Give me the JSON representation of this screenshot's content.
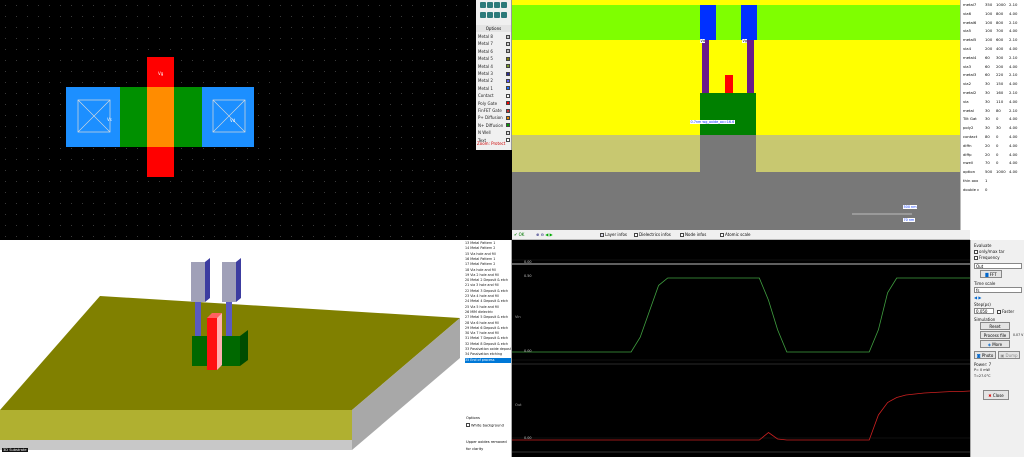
{
  "layout": {
    "labels": {
      "gate": "Vg",
      "drain": "Vd",
      "source": "Vs"
    }
  },
  "palette": {
    "header": "Options",
    "items": [
      {
        "label": "Metal 8",
        "color": "#c8c8c8"
      },
      {
        "label": "Metal 7",
        "color": "#d0d0d0"
      },
      {
        "label": "Metal 6",
        "color": "#b8b8b8"
      },
      {
        "label": "Metal 5",
        "color": "#808000"
      },
      {
        "label": "Metal 4",
        "color": "#7aa02a"
      },
      {
        "label": "Metal 3",
        "color": "#2b2b9b"
      },
      {
        "label": "Metal 2",
        "color": "#5a5aff"
      },
      {
        "label": "Metal 1",
        "color": "#1c6bff"
      },
      {
        "label": "Contact",
        "color": "#ffffff"
      },
      {
        "label": "Poly Gate",
        "color": "#ff0000"
      },
      {
        "label": "FinFET Gate",
        "color": "#cc3333"
      },
      {
        "label": "P+ Diffusion",
        "color": "#e88a00"
      },
      {
        "label": "N+ Diffusion",
        "color": "#00a000"
      },
      {
        "label": "N Well",
        "color": "#dddddd"
      },
      {
        "label": "Text",
        "color": "#ffffff"
      }
    ],
    "zoom_label": "Zoom",
    "zoom_value": "Protect"
  },
  "xsection": {
    "gate_label": "Vg",
    "drain_label": "Vd",
    "annotation": "0.7nm wg_oxide_ox=16.6",
    "scale_label": "500 nm",
    "scale_label2": "70 nm",
    "status": "Substrate"
  },
  "layer_table": {
    "rows": [
      [
        "metal7",
        "350",
        "1000",
        "2.10"
      ],
      [
        "via6",
        "100",
        "800",
        "4.00"
      ],
      [
        "metal6",
        "100",
        "800",
        "2.10"
      ],
      [
        "via5",
        "100",
        "700",
        "4.00"
      ],
      [
        "metal5",
        "100",
        "600",
        "2.10"
      ],
      [
        "via4",
        "200",
        "400",
        "4.00"
      ],
      [
        "metal4",
        "60",
        "300",
        "2.10"
      ],
      [
        "via3",
        "60",
        "200",
        "4.00"
      ],
      [
        "metal3",
        "60",
        "220",
        "2.10"
      ],
      [
        "via2",
        "30",
        "150",
        "4.00"
      ],
      [
        "metal2",
        "30",
        "160",
        "2.10"
      ],
      [
        "via",
        "30",
        "110",
        "4.00"
      ],
      [
        "metal",
        "30",
        "80",
        "2.10"
      ],
      [
        "Tilt Gat",
        "30",
        "0",
        "4.00"
      ],
      [
        "poly2",
        "30",
        "30",
        "4.00"
      ],
      [
        "contact",
        "80",
        "0",
        "4.00"
      ],
      [
        "diffn",
        "20",
        "0",
        "4.00"
      ],
      [
        "diffp",
        "20",
        "0",
        "4.00"
      ],
      [
        "nwell",
        "70",
        "0",
        "4.00"
      ],
      [
        "option",
        "500",
        "1000",
        "4.00"
      ],
      [
        "thin oxx",
        "1",
        "",
        ""
      ],
      [
        "double c",
        "0",
        "",
        ""
      ]
    ]
  },
  "view3d": {
    "status": "3D Substrate"
  },
  "process_list": {
    "items": [
      "13 Metal Pattern 1",
      "14 Metal Pattern 2",
      "15 Via hole and fill",
      "16 Metal Pattern 1",
      "17 Metal Pattern 2",
      "18 Via hole and fill",
      "19 Via 2 hole and fill",
      "20 Metal 2 Deposit & etch",
      "21 via 3 hole and fill",
      "22 Metal 3 Deposit & etch",
      "23 Via 4 hole and fill",
      "24 Metal 4 Deposit & etch",
      "25 Via 5 hole and fill",
      "26 MIM dielectric",
      "27 Metal 5 Deposit & etch",
      "28 Via 6 hole and fill",
      "29 Metal 6 Deposit & etch",
      "30 Via 7 hole and fill",
      "31 Metal 7 Deposit & etch",
      "32 Metal 8 Deposit & etch",
      "33 Passivation oxide deposit",
      "34 Passivation etching",
      "35 End of process"
    ],
    "selected_index": 22,
    "options_label": "Options",
    "white_bg_label": "White background",
    "upper_oxides_label": "Upper oxides removed",
    "for_clarity_label": "for clarity"
  },
  "sim_toolbar": {
    "ok": "OK",
    "layer_infos": "Layer infos",
    "dielectrics_infos": "Dielectrics infos",
    "node_infos": "Node infos",
    "atomic_scale": "Atomic scale"
  },
  "sim_plot": {
    "ticks": {
      "top": "0.00",
      "mid_hi": "0.50",
      "mid_lo": "0.00",
      "bottom": "0.00"
    },
    "labels": {
      "vin": "Vin",
      "out": "Out"
    }
  },
  "chart_data": {
    "type": "line",
    "title": "",
    "xlabel": "",
    "ylabel": "",
    "x": [
      0,
      0.02,
      0.04,
      0.06,
      0.08,
      0.1,
      0.12,
      0.14,
      0.16,
      0.18,
      0.2,
      0.22,
      0.24,
      0.26,
      0.28,
      0.3,
      0.32,
      0.34,
      0.36,
      0.38,
      0.4,
      0.42,
      0.44,
      0.46,
      0.48,
      0.5,
      0.52,
      0.54,
      0.56,
      0.58,
      0.6,
      0.62,
      0.64,
      0.66,
      0.68,
      0.7,
      0.72,
      0.74,
      0.76,
      0.78,
      0.8,
      0.82,
      0.84,
      0.86,
      0.88,
      0.9,
      0.92,
      0.94,
      0.96,
      0.98,
      1.0
    ],
    "series": [
      {
        "values": [
          0,
          0,
          0,
          0,
          0,
          0,
          0,
          0,
          0,
          0,
          0,
          0,
          0,
          0,
          0,
          0,
          0,
          0,
          0,
          0,
          0,
          0,
          0,
          0,
          0,
          0,
          0,
          0,
          0,
          0,
          0,
          0,
          0,
          0,
          0,
          0,
          0,
          0,
          0,
          0,
          0,
          0,
          0,
          0,
          0,
          0,
          0,
          0,
          0,
          0,
          0
        ]
      },
      {
        "values": [
          0,
          0,
          0,
          0,
          0,
          0,
          0,
          0,
          0,
          0,
          0,
          0,
          0,
          0,
          0.2,
          0.55,
          0.9,
          1,
          1,
          1,
          1,
          1,
          1,
          1,
          1,
          1,
          1,
          1,
          0.7,
          0.3,
          0,
          0,
          0,
          0,
          0,
          0,
          0,
          0,
          0,
          0,
          0.3,
          0.8,
          1,
          1,
          1,
          1,
          1,
          1,
          1,
          1,
          1
        ]
      },
      {
        "values": [
          0,
          0,
          0,
          0,
          0,
          0,
          0,
          0,
          0,
          0,
          0,
          0,
          0,
          0,
          0,
          0,
          0,
          0,
          0,
          0,
          0,
          0,
          0,
          0,
          0,
          0,
          0,
          0,
          0.15,
          0.02,
          0,
          0,
          0,
          0,
          0,
          0,
          0,
          0,
          0,
          0,
          0.5,
          0.75,
          0.85,
          0.9,
          0.92,
          0.94,
          0.95,
          0.96,
          0.97,
          0.97,
          0.98
        ]
      }
    ]
  },
  "right_panel": {
    "evaluate_label": "Evaluate",
    "cb1": "only/max tar",
    "cb2": "Frequency",
    "select1": "Out",
    "fft_label": "FFT",
    "time_scale_label": "Time scale",
    "time_scale_value": "fs",
    "step_label": "Step(ps)",
    "step_value": "0.050",
    "faster_label": "Faster",
    "simulation_label": "Simulation",
    "reset_label": "Reset",
    "process_file_label": "Process file",
    "more_label": "More",
    "time_readout": "0.07 V",
    "photo_label": "Photo",
    "dump_label": "Dump",
    "power_label": "Power: 7",
    "power_line2": "P= 0 mW",
    "power_line3": "T=27.0°C",
    "close_label": "Close"
  },
  "colors": {
    "metal1": "#0050ff",
    "metal_blue_3d": "#3c3ca0",
    "via_purple": "#6a1a8a",
    "poly_red": "#ff0000",
    "diff_orange": "#ff8c00",
    "diff_green": "#008c00",
    "oxide_yellow": "#ffff00",
    "thick_oxide": "#c8c870",
    "green_layer": "#7fff00",
    "substrate_gray": "#787878",
    "vin_trace": "#40a040",
    "out_trace": "#cc2020"
  }
}
